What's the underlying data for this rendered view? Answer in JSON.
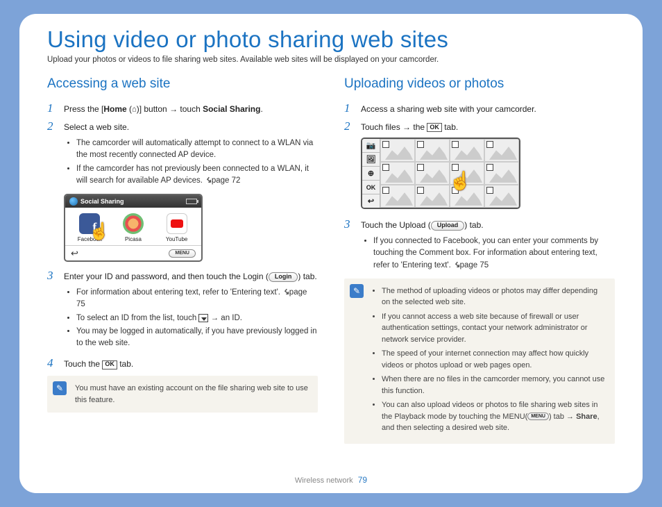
{
  "title": "Using video or photo sharing web sites",
  "intro": "Upload your photos or videos to file sharing web sites. Available web sites will be displayed on your camcorder.",
  "left": {
    "heading": "Accessing a web site",
    "step1_a": "Press the [",
    "step1_home": "Home",
    "step1_b": " (",
    "step1_c": ")] button → touch ",
    "step1_social": "Social Sharing",
    "step1_d": ".",
    "step2": "Select a web site.",
    "step2_bullets": [
      "The camcorder will automatically attempt to connect to a WLAN via the most recently connected AP device.",
      "If the camcorder has not previously been connected to a WLAN, it will search for available AP devices. "
    ],
    "page72_ref": "page 72",
    "cam_title": "Social Sharing",
    "apps": {
      "fb": "Facebook",
      "pic": "Picasa",
      "yt": "YouTube"
    },
    "menu_label": "MENU",
    "step3_a": "Enter your ID and password, and then touch the Login (",
    "login_label": "Login",
    "step3_b": ") tab.",
    "step3_bullets_a": "For information about entering text, refer to 'Entering text'. ",
    "page75_ref": "page 75",
    "step3_bullets_b": "To select an ID from the list, touch ",
    "step3_bullets_b_tail": " → an ID.",
    "step3_bullets_c": "You may be logged in automatically, if you have previously logged in to the web site.",
    "step4_a": "Touch the ",
    "ok_label": "OK",
    "step4_b": " tab.",
    "note": "You must have an existing account on the file sharing web site to use this feature."
  },
  "right": {
    "heading": "Uploading videos or photos",
    "step1": "Access a sharing web site with your camcorder.",
    "step2_a": "Touch files → the ",
    "step2_b": " tab.",
    "side_icons": [
      "📷",
      "🖼",
      "⊕",
      "OK",
      "↩"
    ],
    "step3_a": "Touch the Upload (",
    "upload_label": "Upload",
    "step3_b": ") tab.",
    "step3_bullet": "If you connected to Facebook, you can enter your comments by touching the Comment box. For information about entering text, refer to 'Entering text'. ",
    "page75_ref": "page 75",
    "notes": [
      "The method of uploading videos or photos may differ depending on the selected web site.",
      "If you cannot access a web site because of firewall or user authentication settings, contact your network administrator or network service provider.",
      "The speed of your internet connection may affect how quickly videos or photos upload or web pages open.",
      "When there are no files in the camcorder memory, you cannot use this function."
    ],
    "note_last_a": "You can also upload videos or photos to file sharing web sites in the Playback mode by touching the MENU(",
    "note_last_menu": "MENU",
    "note_last_b": ") tab → ",
    "note_last_share": "Share",
    "note_last_c": ", and then selecting a desired web site."
  },
  "footer": {
    "section": "Wireless network",
    "page": "79"
  }
}
